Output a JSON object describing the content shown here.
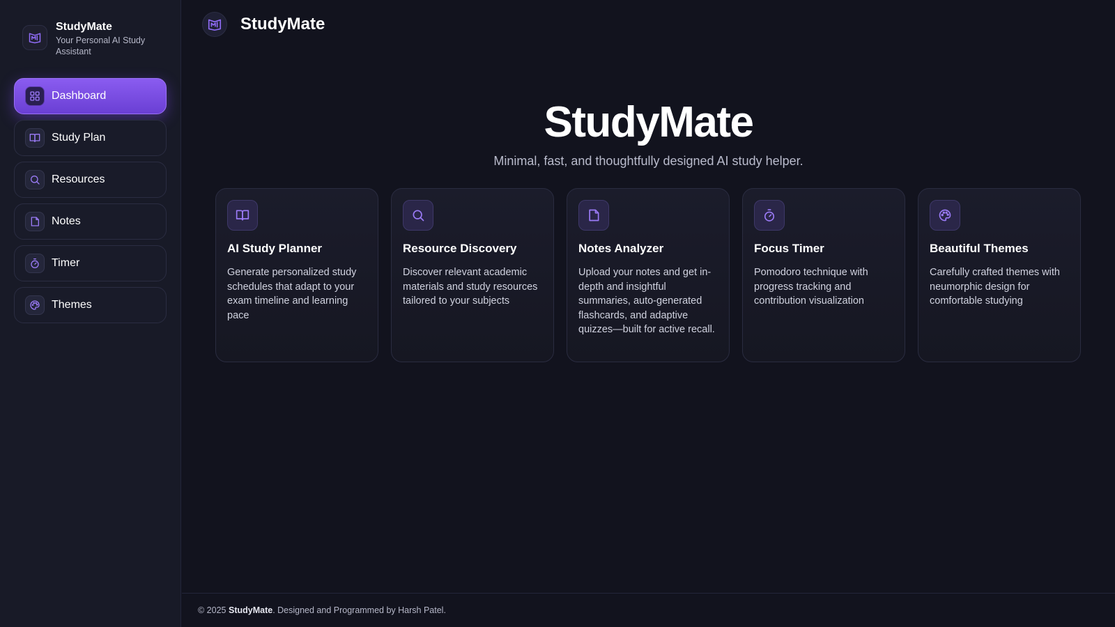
{
  "sidebar": {
    "brand_title": "StudyMate",
    "brand_subtitle": "Your Personal AI Study Assistant",
    "items": [
      {
        "label": "Dashboard",
        "icon": "grid-icon",
        "active": true
      },
      {
        "label": "Study Plan",
        "icon": "book-icon",
        "active": false
      },
      {
        "label": "Resources",
        "icon": "search-icon",
        "active": false
      },
      {
        "label": "Notes",
        "icon": "note-icon",
        "active": false
      },
      {
        "label": "Timer",
        "icon": "stopwatch-icon",
        "active": false
      },
      {
        "label": "Themes",
        "icon": "palette-icon",
        "active": false
      }
    ]
  },
  "header": {
    "title": "StudyMate"
  },
  "hero": {
    "title": "StudyMate",
    "subtitle": "Minimal, fast, and thoughtfully designed AI study helper."
  },
  "features": [
    {
      "title": "AI Study Planner",
      "icon": "book-icon",
      "description": "Generate personalized study schedules that adapt to your exam timeline and learning pace"
    },
    {
      "title": "Resource Discovery",
      "icon": "search-icon",
      "description": "Discover relevant academic materials and study resources tailored to your subjects"
    },
    {
      "title": "Notes Analyzer",
      "icon": "note-icon",
      "description": "Upload your notes and get in-depth and insightful summaries, auto-generated flashcards, and adaptive quizzes—built for active recall."
    },
    {
      "title": "Focus Timer",
      "icon": "stopwatch-icon",
      "description": "Pomodoro technique with progress tracking and contribution visualization"
    },
    {
      "title": "Beautiful Themes",
      "icon": "palette-icon",
      "description": "Carefully crafted themes with neumorphic design for comfortable studying"
    }
  ],
  "footer": {
    "prefix": "© 2025 ",
    "brand": "StudyMate",
    "suffix": ". Designed and Programmed by Harsh Patel."
  },
  "colors": {
    "accent": "#7c4dff",
    "icon": "#8f6cf5",
    "background": "#12131e",
    "sidebar": "#181a27"
  }
}
